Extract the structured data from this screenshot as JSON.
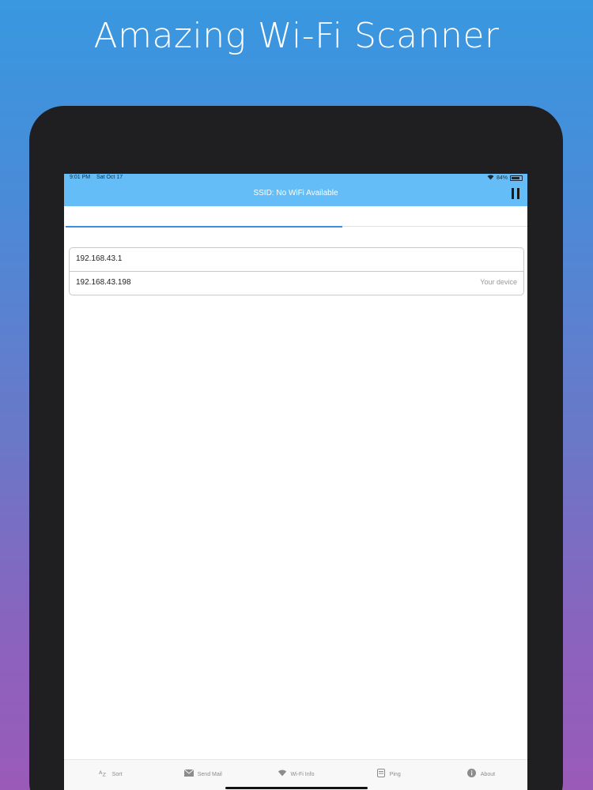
{
  "promo": {
    "headline": "Amazing Wi-Fi Scanner"
  },
  "status_bar": {
    "time": "9:01 PM",
    "date": "Sat Oct 17",
    "battery": "84%"
  },
  "nav": {
    "title": "SSID: No WiFi Available",
    "action_icon": "pause-icon"
  },
  "scan": {
    "progress_fraction": 0.6
  },
  "devices": [
    {
      "ip": "192.168.43.1",
      "note": ""
    },
    {
      "ip": "192.168.43.198",
      "note": "Your device"
    }
  ],
  "tabs": [
    {
      "label": "Sort",
      "icon": "sort-az-icon"
    },
    {
      "label": "Send Mail",
      "icon": "mail-icon"
    },
    {
      "label": "Wi-Fi Info",
      "icon": "wifi-icon"
    },
    {
      "label": "Ping",
      "icon": "ping-icon"
    },
    {
      "label": "About",
      "icon": "info-icon"
    }
  ],
  "colors": {
    "nav_background": "#64bdf6",
    "progress": "#3a8fe0",
    "device_frame": "#1f1f22"
  }
}
